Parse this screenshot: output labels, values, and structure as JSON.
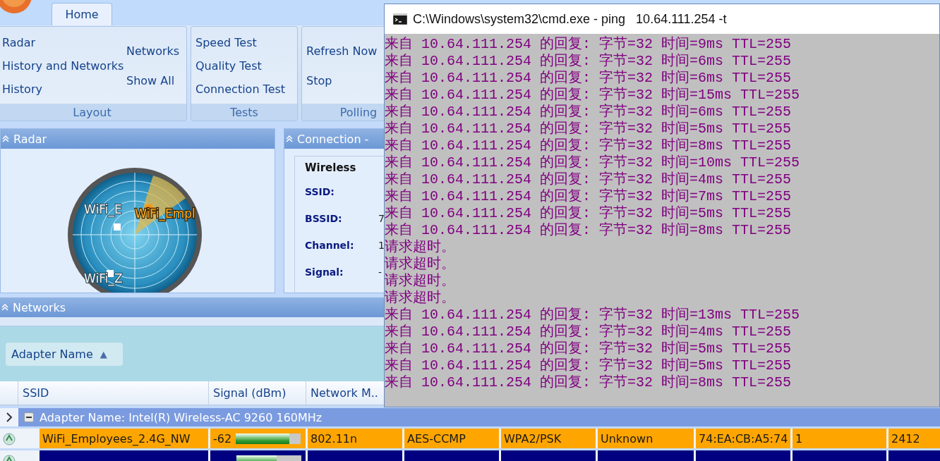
{
  "app": {
    "tabs": [
      {
        "label": "Home",
        "selected": true
      }
    ],
    "ribbon_groups": [
      {
        "label": "Layout",
        "columns": [
          [
            "Radar",
            "History and Networks",
            "History"
          ],
          [
            "Networks",
            "Show All"
          ]
        ]
      },
      {
        "label": "Tests",
        "columns": [
          [
            "Speed Test",
            "Quality Test",
            "Connection Test"
          ]
        ]
      },
      {
        "label": "Polling",
        "columns": [
          [
            "Refresh Now",
            "Stop"
          ]
        ]
      }
    ],
    "radar_panel": {
      "title": "Radar",
      "networks": [
        {
          "label": "WiFi_E",
          "selected": false
        },
        {
          "label": "WiFi_Empl",
          "selected": true
        },
        {
          "label": "WiFi_Z",
          "selected": false
        }
      ]
    },
    "connection_panel": {
      "title": "Connection -",
      "group_title": "Wireless",
      "fields": [
        {
          "label": "SSID:"
        },
        {
          "label": "BSSID:",
          "value": "7"
        },
        {
          "label": "Channel:",
          "value": "1"
        },
        {
          "label": "Signal:",
          "value": "-"
        }
      ]
    },
    "networks_panel": {
      "title": "Networks",
      "group_by": {
        "label": "Adapter Name",
        "sort_icon": "▲"
      },
      "columns": [
        "SSID",
        "Signal (dBm)",
        "Network M.."
      ],
      "group_row": {
        "text": "Adapter Name: Intel(R) Wireless-AC 9260 160MHz",
        "expanded": true
      },
      "rows": [
        {
          "color": "#ffa500",
          "level": 0.82,
          "cells": [
            "WiFi_Employees_2.4G_NW",
            "-62",
            "802.11n",
            "AES-CCMP",
            "WPA2/PSK",
            "Unknown",
            "74:EA:CB:A5:74",
            "1",
            "2412"
          ]
        },
        {
          "color": "#000080",
          "level": 0.62
        }
      ]
    }
  },
  "console": {
    "title": "C:\\Windows\\system32\\cmd.exe - ping   10.64.111.254 -t",
    "lines": [
      "来自 10.64.111.254 的回复: 字节=32 时间=9ms TTL=255",
      "来自 10.64.111.254 的回复: 字节=32 时间=6ms TTL=255",
      "来自 10.64.111.254 的回复: 字节=32 时间=6ms TTL=255",
      "来自 10.64.111.254 的回复: 字节=32 时间=15ms TTL=255",
      "来自 10.64.111.254 的回复: 字节=32 时间=6ms TTL=255",
      "来自 10.64.111.254 的回复: 字节=32 时间=5ms TTL=255",
      "来自 10.64.111.254 的回复: 字节=32 时间=8ms TTL=255",
      "来自 10.64.111.254 的回复: 字节=32 时间=10ms TTL=255",
      "来自 10.64.111.254 的回复: 字节=32 时间=4ms TTL=255",
      "来自 10.64.111.254 的回复: 字节=32 时间=7ms TTL=255",
      "来自 10.64.111.254 的回复: 字节=32 时间=5ms TTL=255",
      "来自 10.64.111.254 的回复: 字节=32 时间=8ms TTL=255",
      "请求超时。",
      "请求超时。",
      "请求超时。",
      "请求超时。",
      "来自 10.64.111.254 的回复: 字节=32 时间=13ms TTL=255",
      "来自 10.64.111.254 的回复: 字节=32 时间=4ms TTL=255",
      "来自 10.64.111.254 的回复: 字节=32 时间=5ms TTL=255",
      "来自 10.64.111.254 的回复: 字节=32 时间=5ms TTL=255",
      "来自 10.64.111.254 的回复: 字节=32 时间=8ms TTL=255"
    ]
  }
}
